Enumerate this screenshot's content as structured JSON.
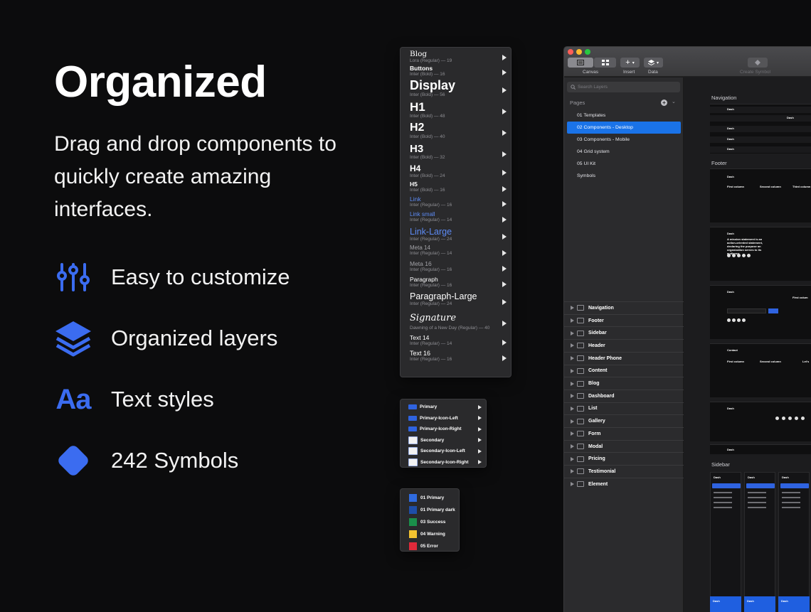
{
  "hero": {
    "title": "Organized",
    "subtitle": "Drag and drop components to quickly create amazing interfaces."
  },
  "features": [
    {
      "icon": "sliders-icon",
      "label": "Easy to customize"
    },
    {
      "icon": "layers-icon",
      "label": "Organized layers"
    },
    {
      "icon": "text-styles-icon",
      "glyph": "Aa",
      "label": "Text styles"
    },
    {
      "icon": "symbol-diamond-icon",
      "label": "242 Symbols"
    }
  ],
  "type_styles": [
    {
      "name": "Blog",
      "meta": "Lora (Regular) — 19"
    },
    {
      "name": "Buttons",
      "meta": "Inter (Bold) — 16"
    },
    {
      "name": "Display",
      "meta": "Inter (Bold) — 56"
    },
    {
      "name": "H1",
      "meta": "Inter (Bold) — 48"
    },
    {
      "name": "H2",
      "meta": "Inter (Bold) — 40"
    },
    {
      "name": "H3",
      "meta": "Inter (Bold) — 32"
    },
    {
      "name": "H4",
      "meta": "Inter (Bold) — 24"
    },
    {
      "name": "H5",
      "meta": "Inter (Bold) — 16"
    },
    {
      "name": "Link",
      "meta": "Inter (Regular) — 16"
    },
    {
      "name": "Link small",
      "meta": "Inter (Regular) — 14"
    },
    {
      "name": "Link-Large",
      "meta": "Inter (Regular) — 24"
    },
    {
      "name": "Meta 14",
      "meta": "Inter (Regular) — 14"
    },
    {
      "name": "Meta 16",
      "meta": "Inter (Regular) — 16"
    },
    {
      "name": "Paragraph",
      "meta": "Inter (Regular) — 16"
    },
    {
      "name": "Paragraph-Large",
      "meta": "Inter (Regular) — 24"
    },
    {
      "name": "Signature",
      "meta": "Dawning of a New Day (Regular) — 40"
    },
    {
      "name": "Text 14",
      "meta": "Inter (Regular) — 14"
    },
    {
      "name": "Text 16",
      "meta": "Inter (Regular) — 16"
    }
  ],
  "button_symbols": [
    {
      "label": "Primary",
      "kind": "primary"
    },
    {
      "label": "Primary-Icon-Left",
      "kind": "primary"
    },
    {
      "label": "Primary-Icon-Right",
      "kind": "primary"
    },
    {
      "label": "Secondary",
      "kind": "secondary"
    },
    {
      "label": "Secondary-Icon-Left",
      "kind": "secondary"
    },
    {
      "label": "Secondary-Icon-Right",
      "kind": "secondary"
    }
  ],
  "colors": [
    {
      "label": "01 Primary",
      "hex": "#2f6be0"
    },
    {
      "label": "01 Primary dark",
      "hex": "#1e4ea8"
    },
    {
      "label": "03 Success",
      "hex": "#1a8f4a"
    },
    {
      "label": "04 Warning",
      "hex": "#f2c230"
    },
    {
      "label": "05 Error",
      "hex": "#e02a3a"
    }
  ],
  "app": {
    "toolbar": {
      "canvas": "Canvas",
      "insert": "Insert",
      "data": "Data",
      "create_symbol": "Create Symbol"
    },
    "search_placeholder": "Search Layers",
    "pages_label": "Pages",
    "pages": [
      "01 Templates",
      "02 Components - Desktop",
      "03 Components - Mobile",
      "04 Grid system",
      "05 UI Kit",
      "Symbols"
    ],
    "selected_page": "02 Components - Desktop",
    "layers": [
      "Navigation",
      "Footer",
      "Sidebar",
      "Header",
      "Header Phone",
      "Content",
      "Blog",
      "Dashboard",
      "List",
      "Gallery",
      "Form",
      "Modal",
      "Pricing",
      "Testimonial",
      "Element"
    ],
    "canvas_sections": [
      "Navigation",
      "Footer",
      "Sidebar"
    ],
    "canvas_text": {
      "brand": "Dash",
      "first_column": "First column",
      "second_column": "Second column",
      "third_column": "Third column",
      "first_column_short": "First colum",
      "mission": "A mission statement is an action-oriented statement, declaring the purpose an organization serves to its audience.",
      "contact": "Contact",
      "lets": "Let's"
    }
  },
  "accent_color": "#3b6cf0"
}
